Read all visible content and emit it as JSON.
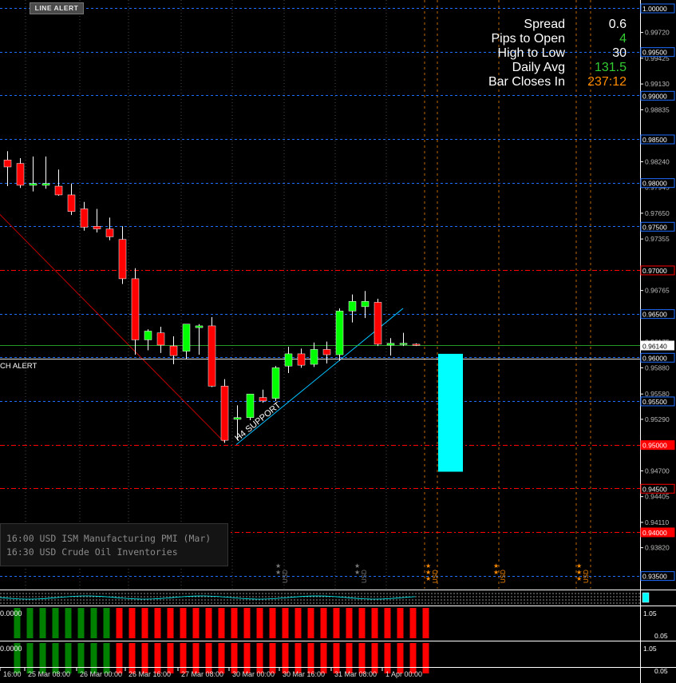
{
  "toolbar": {
    "line_alert_label": "LINE ALERT"
  },
  "info": {
    "rows": [
      {
        "label": "Spread",
        "value": "0.6",
        "color": "#ffffff"
      },
      {
        "label": "Pips to Open",
        "value": "4",
        "color": "#32cd32"
      },
      {
        "label": "High to Low",
        "value": "30",
        "color": "#ffffff"
      },
      {
        "label": "Daily Avg",
        "value": "131.5",
        "color": "#32cd32"
      },
      {
        "label": "Bar Closes In",
        "value": "237:12",
        "color": "#ff8c00"
      }
    ]
  },
  "news": {
    "items": [
      "16:00 USD ISM Manufacturing PMI (Mar)",
      "16:30 USD Crude Oil Inventories"
    ]
  },
  "labels": {
    "touch_alert": "CH ALERT",
    "h4_support": "H4 SUPPORT"
  },
  "news_markers": [
    {
      "currency": "USD",
      "impact": 2,
      "color": "#7a7a7a"
    },
    {
      "currency": "USD",
      "impact": 2,
      "color": "#7a7a7a"
    },
    {
      "currency": "USD",
      "impact": 3,
      "color": "#ff8c00"
    },
    {
      "currency": "USD",
      "impact": 2,
      "color": "#ff8c00"
    },
    {
      "currency": "USD",
      "impact": 3,
      "color": "#ff8c00"
    }
  ],
  "colors": {
    "bull": "#00ff00",
    "bear": "#ff0000",
    "grid_blue": "#1e6eff",
    "grid_orange": "#ff8c00",
    "price_line": "#32cd32",
    "support_line": "#00bfff",
    "trend_line": "#c00000",
    "target_box": "#00ffff",
    "histogram_green": "#008000",
    "histogram_red": "#ff0000"
  },
  "chart_data": {
    "type": "candlestick",
    "symbol_digits": 5,
    "ylim": [
      0.9335,
      1.0
    ],
    "current_price": "0.96140",
    "price_ticks": [
      "1.00000",
      "0.99720",
      "0.99425",
      "0.99130",
      "0.98835",
      "0.98240",
      "0.97945",
      "0.97650",
      "0.97355",
      "0.96765",
      "0.96470",
      "0.96175",
      "0.95880",
      "0.95580",
      "0.95290",
      "0.94700",
      "0.94405",
      "0.94110",
      "0.93820"
    ],
    "blue_levels": [
      "1.00000",
      "0.99500",
      "0.99000",
      "0.98500",
      "0.98000",
      "0.97500",
      "0.96500",
      "0.96000",
      "0.95500",
      "0.93500"
    ],
    "red_levels": [
      "0.97000",
      "0.95000",
      "0.94500",
      "0.94000"
    ],
    "level_label_fill": {
      "0.95000": "#ff0000",
      "0.94000": "#ff0000"
    },
    "time_labels": [
      "16:00",
      "25 Mar 08:00",
      "26 Mar 00:00",
      "26 Mar 16:00",
      "27 Mar 08:00",
      "30 Mar 00:00",
      "30 Mar 16:00",
      "31 Mar 08:00",
      "1 Apr 00:00"
    ],
    "candles": [
      {
        "o": 0.9826,
        "h": 0.9836,
        "l": 0.9796,
        "c": 0.9818
      },
      {
        "o": 0.9822,
        "h": 0.9828,
        "l": 0.9794,
        "c": 0.9797
      },
      {
        "o": 0.9797,
        "h": 0.983,
        "l": 0.979,
        "c": 0.9799
      },
      {
        "o": 0.9797,
        "h": 0.983,
        "l": 0.9793,
        "c": 0.9799
      },
      {
        "o": 0.9796,
        "h": 0.9815,
        "l": 0.9785,
        "c": 0.9786
      },
      {
        "o": 0.9786,
        "h": 0.9799,
        "l": 0.9763,
        "c": 0.9767
      },
      {
        "o": 0.977,
        "h": 0.9778,
        "l": 0.9745,
        "c": 0.9749
      },
      {
        "o": 0.975,
        "h": 0.977,
        "l": 0.9743,
        "c": 0.9747
      },
      {
        "o": 0.9747,
        "h": 0.976,
        "l": 0.9734,
        "c": 0.9738
      },
      {
        "o": 0.9735,
        "h": 0.975,
        "l": 0.9684,
        "c": 0.969
      },
      {
        "o": 0.969,
        "h": 0.9702,
        "l": 0.9603,
        "c": 0.962
      },
      {
        "o": 0.962,
        "h": 0.9632,
        "l": 0.9608,
        "c": 0.963
      },
      {
        "o": 0.9628,
        "h": 0.9635,
        "l": 0.9605,
        "c": 0.9614
      },
      {
        "o": 0.9613,
        "h": 0.9624,
        "l": 0.9592,
        "c": 0.9602
      },
      {
        "o": 0.9607,
        "h": 0.9629,
        "l": 0.9598,
        "c": 0.9638
      },
      {
        "o": 0.9634,
        "h": 0.9638,
        "l": 0.9603,
        "c": 0.9636
      },
      {
        "o": 0.9636,
        "h": 0.9646,
        "l": 0.9566,
        "c": 0.9567
      },
      {
        "o": 0.9567,
        "h": 0.9575,
        "l": 0.9502,
        "c": 0.9505
      },
      {
        "o": 0.9529,
        "h": 0.9545,
        "l": 0.9505,
        "c": 0.9531
      },
      {
        "o": 0.9531,
        "h": 0.9557,
        "l": 0.9528,
        "c": 0.9558
      },
      {
        "o": 0.9554,
        "h": 0.9563,
        "l": 0.9548,
        "c": 0.955
      },
      {
        "o": 0.9553,
        "h": 0.959,
        "l": 0.955,
        "c": 0.9588
      },
      {
        "o": 0.959,
        "h": 0.9612,
        "l": 0.9582,
        "c": 0.9604
      },
      {
        "o": 0.9604,
        "h": 0.961,
        "l": 0.9588,
        "c": 0.9591
      },
      {
        "o": 0.9592,
        "h": 0.9617,
        "l": 0.9589,
        "c": 0.9609
      },
      {
        "o": 0.9609,
        "h": 0.9618,
        "l": 0.9593,
        "c": 0.9603
      },
      {
        "o": 0.9603,
        "h": 0.9656,
        "l": 0.9596,
        "c": 0.9653
      },
      {
        "o": 0.9653,
        "h": 0.9672,
        "l": 0.964,
        "c": 0.9664
      },
      {
        "o": 0.9658,
        "h": 0.9676,
        "l": 0.9645,
        "c": 0.9664
      },
      {
        "o": 0.9663,
        "h": 0.9667,
        "l": 0.9613,
        "c": 0.9615
      },
      {
        "o": 0.9614,
        "h": 0.9622,
        "l": 0.9602,
        "c": 0.9616
      },
      {
        "o": 0.9615,
        "h": 0.9628,
        "l": 0.9613,
        "c": 0.9616
      },
      {
        "o": 0.9615,
        "h": 0.9616,
        "l": 0.9613,
        "c": 0.9614
      }
    ],
    "support_line": {
      "from": {
        "bar": 18,
        "price": 0.95
      },
      "to": {
        "bar": 31,
        "price": 0.9656
      }
    },
    "trend_line": {
      "from": {
        "bar": -1,
        "price": 0.977
      },
      "to": {
        "bar": 17,
        "price": 0.9503
      }
    },
    "target_zone": {
      "top": 0.9604,
      "bottom": 0.9469
    },
    "touch_alert_level": 0.9598,
    "histogram_1": {
      "label": "0.0000",
      "right_labels": [
        "1.05",
        "0.05"
      ],
      "colors": [
        "g",
        "g",
        "g",
        "g",
        "g",
        "g",
        "g",
        "g",
        "r",
        "r",
        "r",
        "r",
        "r",
        "r",
        "r",
        "r",
        "r",
        "r",
        "r",
        "r",
        "r",
        "r",
        "r",
        "r",
        "r",
        "r",
        "r",
        "r",
        "r",
        "r",
        "r",
        "r",
        "r"
      ]
    },
    "histogram_2": {
      "label": "0.0000",
      "right_labels": [
        "1.05",
        "0.05"
      ],
      "colors": [
        "g",
        "g",
        "g",
        "g",
        "g",
        "g",
        "g",
        "g",
        "r",
        "r",
        "r",
        "r",
        "r",
        "r",
        "r",
        "r",
        "r",
        "r",
        "r",
        "r",
        "r",
        "r",
        "r",
        "r",
        "r",
        "r",
        "r",
        "r",
        "r",
        "r",
        "r",
        "r",
        "r"
      ]
    }
  }
}
